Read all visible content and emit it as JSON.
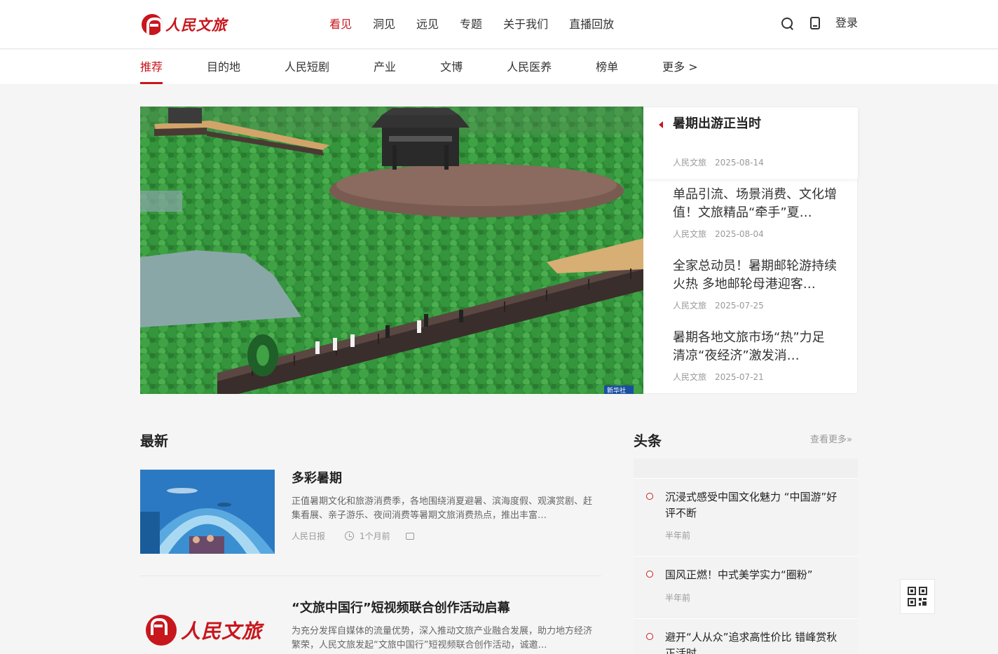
{
  "header": {
    "logo_text": "人民文旅",
    "nav": [
      {
        "label": "看见",
        "active": true
      },
      {
        "label": "洞见"
      },
      {
        "label": "远见"
      },
      {
        "label": "专题"
      },
      {
        "label": "关于我们"
      },
      {
        "label": "直播回放"
      }
    ],
    "login_label": "登录",
    "icons": [
      "search-icon",
      "phone-icon"
    ]
  },
  "channels": [
    {
      "label": "推荐",
      "active": true
    },
    {
      "label": "目的地"
    },
    {
      "label": "人民短剧"
    },
    {
      "label": "产业"
    },
    {
      "label": "文博"
    },
    {
      "label": "人民医养"
    },
    {
      "label": "榜单"
    },
    {
      "label": "更多 >"
    }
  ],
  "hero": {
    "image_badge": "新华社",
    "items": [
      {
        "title": "暑期出游正当时",
        "source": "人民文旅",
        "date": "2025-08-14"
      },
      {
        "title": "单品引流、场景消费、文化增值！文旅精品“牵手”夏…",
        "source": "人民文旅",
        "date": "2025-08-04"
      },
      {
        "title": "全家总动员！暑期邮轮游持续火热 多地邮轮母港迎客…",
        "source": "人民文旅",
        "date": "2025-07-25"
      },
      {
        "title": "暑期各地文旅市场“热”力足 清凉“夜经济”激发消…",
        "source": "人民文旅",
        "date": "2025-07-21"
      }
    ]
  },
  "latest": {
    "title": "最新",
    "items": [
      {
        "title": "多彩暑期",
        "desc": "正值暑期文化和旅游消费季，各地围绕消夏避暑、滨海度假、观演赏剧、赶集看展、亲子游乐、夜间消费等暑期文旅消费热点，推出丰富…",
        "source": "人民日报",
        "time": "1个月前"
      },
      {
        "title": "“文旅中国行”短视频联合创作活动启幕",
        "desc": "为充分发挥自媒体的流量优势，深入推动文旅产业融合发展，助力地方经济繁荣，人民文旅发起“文旅中国行”短视频联合创作活动，诚邀…",
        "thumb_logo": "人民文旅"
      }
    ]
  },
  "headlines": {
    "title": "头条",
    "more_label": "查看更多»",
    "items": [
      {
        "title": "沉浸式感受中国文化魅力 “中国游”好评不断",
        "ago": "半年前"
      },
      {
        "title": "国风正燃！中式美学实力“圈粉”",
        "ago": "半年前"
      },
      {
        "title": "避开“人从众”追求高性价比 错峰赏秋正活时",
        "ago": ""
      }
    ]
  },
  "colors": {
    "accent": "#c8161d"
  }
}
